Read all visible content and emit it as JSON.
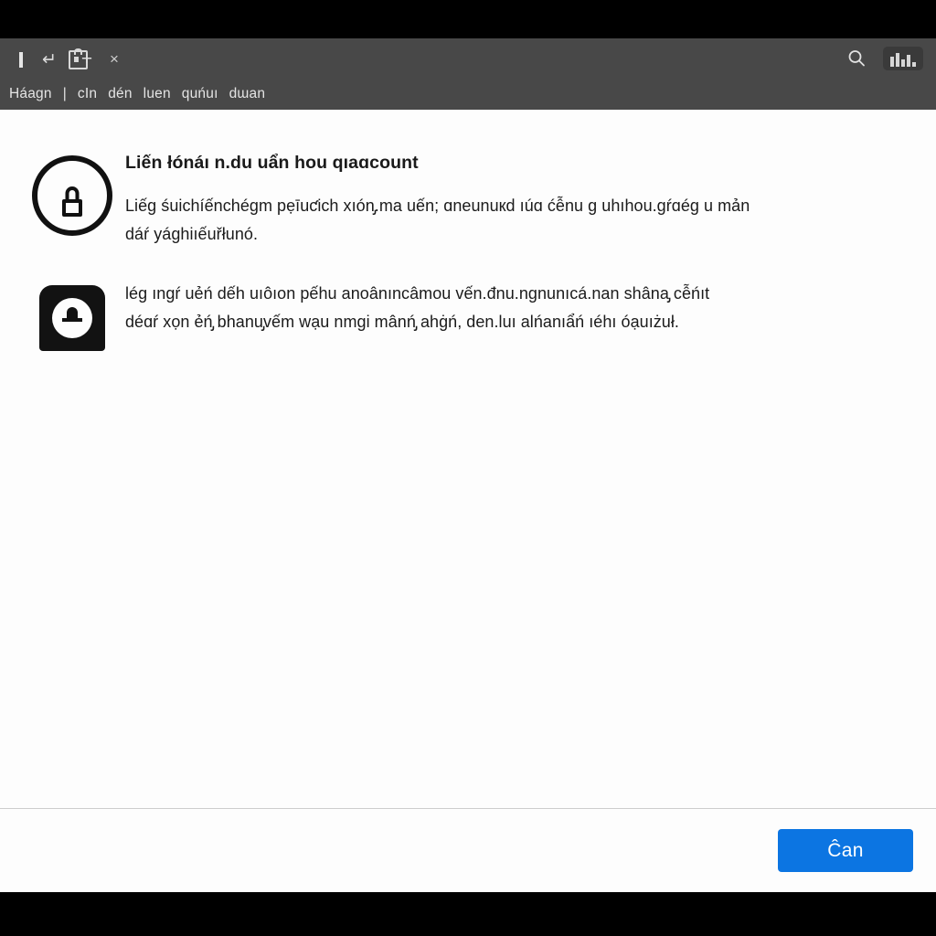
{
  "browser": {
    "tab_icons": [
      {
        "name": "bar-glyph-icon",
        "label": "|"
      },
      {
        "name": "back-curve-icon",
        "label": "↩"
      },
      {
        "name": "lock-tab-icon",
        "label": "lock"
      }
    ],
    "new_tab_label": "+",
    "close_tab_label": "×",
    "search_icon_name": "search-icon",
    "profile_icon_name": "profile-bars-icon",
    "bookmarks": [
      {
        "label": "Háaɡn"
      },
      {
        "label": "|"
      },
      {
        "label": "cIn"
      },
      {
        "label": "dén"
      },
      {
        "label": "luen"
      },
      {
        "label": "quńuı"
      },
      {
        "label": "dɯan"
      }
    ]
  },
  "content": {
    "blocks": [
      {
        "icon": "lock-circle-icon",
        "heading_plain": "Liến łónáı n.du uẩn hou qıaɑ",
        "heading_bold": "count",
        "paragraphs": [
          "Liếɡ śuichíếnchéɡm pẹīuƈich xıón̡.ma uến; ɑneunuкԁ ıúɑ ćễnu g uhıhou.ɡŕɑéɡ u mản",
          "dáŕ уáɡhiıếuřłunó."
        ]
      },
      {
        "icon": "lock-solid-icon",
        "paragraphs": [
          "léɡ ınɡŕ uẻń dếh uıôıon pếhu anoânıncâmou vến.đnu.nɡnunıcá.nan shâna̡ cễńıt",
          "déɑŕ xọn ẻń̡ bhanu̡vếm wạu nmgi mânń̡ ahġń, den.luı alńanıẩń ıéhı óạuıżuł."
        ]
      }
    ]
  },
  "footer": {
    "primary_button_label": "Ĉan"
  },
  "colors": {
    "chrome_background": "#484848",
    "page_background": "#fdfdfd",
    "letterbox": "#000000",
    "primary_accent": "#0c75e2",
    "divider": "#cdcdcd",
    "text": "#1b1b1b"
  }
}
